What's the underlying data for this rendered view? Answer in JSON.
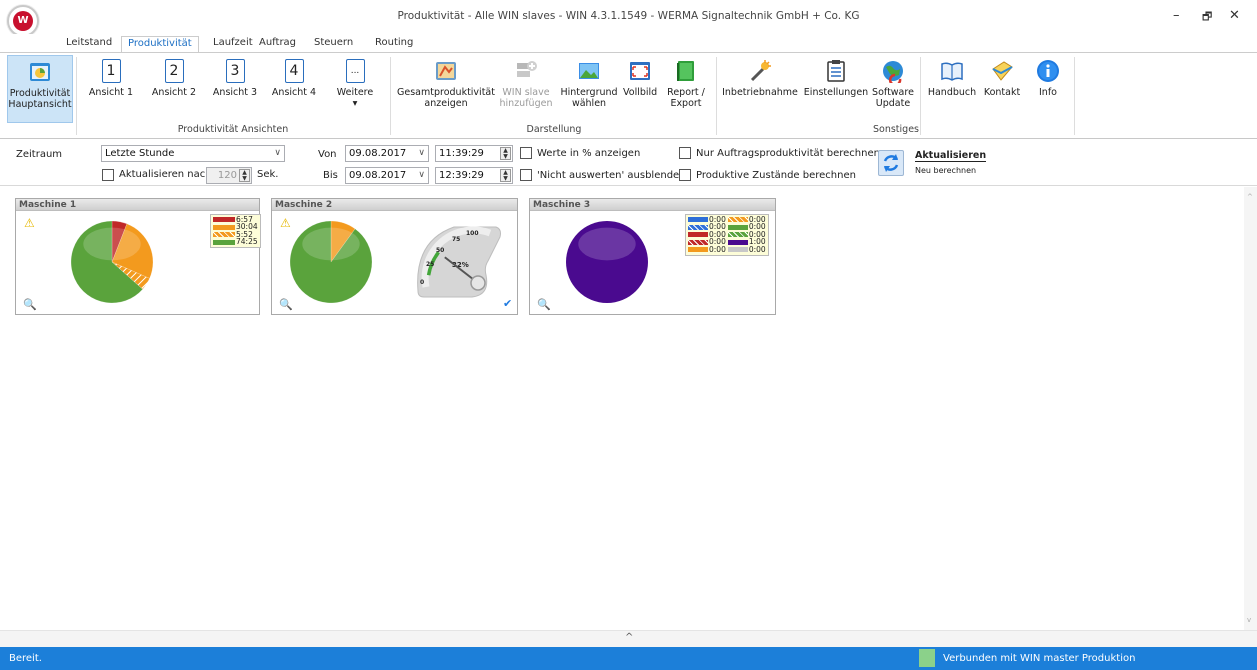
{
  "app": {
    "title": "Produktivität - Alle WIN slaves - WIN 4.3.1.1549 - WERMA Signaltechnik GmbH + Co. KG",
    "logo": "werma-logo"
  },
  "window_controls": {
    "minimize": "–",
    "restore": "🗗",
    "close": "✕",
    "ribbon_up": "^",
    "ribbon_min": "–",
    "ribbon_restore": "🗗",
    "ribbon_close": "✕"
  },
  "tabs": [
    "Leitstand",
    "Produktivität",
    "Laufzeit",
    "Auftrag",
    "Steuern",
    "Routing"
  ],
  "active_tab": "Produktivität",
  "ribbon": {
    "main": {
      "label": "Produktivität Hauptansicht",
      "line1": "Produktivität",
      "line2": "Hauptansicht"
    },
    "views": {
      "v1": "Ansicht 1",
      "v2": "Ansicht 2",
      "v3": "Ansicht 3",
      "v4": "Ansicht 4",
      "more": "Weitere",
      "n1": "1",
      "n2": "2",
      "n3": "3",
      "n4": "4",
      "more_icon": "...",
      "more_arrow": "▾"
    },
    "group_views": "Produktivität Ansichten",
    "gesamt": {
      "line1": "Gesamtproduktivität",
      "line2": "anzeigen"
    },
    "winslave": {
      "line1": "WIN slave",
      "line2": "hinzufügen"
    },
    "hintergrund": {
      "line1": "Hintergrund",
      "line2": "wählen"
    },
    "vollbild": "Vollbild",
    "report": {
      "line1": "Report /",
      "line2": "Export"
    },
    "group_darstellung": "Darstellung",
    "inbetrieb": "Inbetriebnahme",
    "einstellungen": "Einstellungen",
    "software": {
      "line1": "Software",
      "line2": "Update"
    },
    "handbuch": "Handbuch",
    "kontakt": "Kontakt",
    "info": "Info",
    "group_sonstiges": "Sonstiges"
  },
  "params": {
    "zeitraum_label": "Zeitraum",
    "zeitraum_value": "Letzte Stunde",
    "aktualisieren_nach": "Aktualisieren nach",
    "interval": "120",
    "sek": "Sek.",
    "von": "Von",
    "bis": "Bis",
    "von_date": "09.08.2017",
    "von_time": "11:39:29",
    "bis_date": "09.08.2017",
    "bis_time": "12:39:29",
    "werte_prozent": "Werte in % anzeigen",
    "nicht_auswerten": "'Nicht auswerten' ausblenden",
    "nur_auftrag": "Nur Auftragsproduktivität berechnen",
    "produktive": "Produktive Zustände berechnen",
    "refresh_title": "Aktualisieren",
    "refresh_sub": "Neu berechnen"
  },
  "colors": {
    "accent": "#1c7fd9",
    "green": "#5aa33c",
    "orange": "#f39a1e",
    "red": "#c02828",
    "purple": "#4a0a8f",
    "blue": "#2f6fd8",
    "gray": "#c8c8c8"
  },
  "machines": [
    {
      "name": "Maschine 1",
      "legend": [
        "6:57",
        "30:04",
        "5:52",
        "74:25"
      ],
      "pie": [
        {
          "color": "#c02828",
          "value": 6.95
        },
        {
          "color": "#f39a1e",
          "value": 30.07
        },
        {
          "color": "hatch",
          "value": 5.87
        },
        {
          "color": "#5aa33c",
          "value": 74.42
        }
      ]
    },
    {
      "name": "Maschine 2",
      "pie": [
        {
          "color": "#f39a1e",
          "value": 10
        },
        {
          "color": "#5aa33c",
          "value": 90
        }
      ],
      "gauge": {
        "value": 32,
        "percent": "32%",
        "ticks": [
          "0",
          "25",
          "50",
          "75",
          "100"
        ]
      }
    },
    {
      "name": "Maschine 3",
      "legend_left": [
        "0:00",
        "0:00",
        "0:00",
        "0:00",
        "0:00"
      ],
      "legend_right": [
        "0:00",
        "0:00",
        "0:00",
        "1:00",
        "0:00"
      ],
      "pie": [
        {
          "color": "#4a0a8f",
          "value": 100
        }
      ]
    }
  ],
  "status": {
    "left": "Bereit.",
    "right": "Verbunden mit WIN master Produktion"
  }
}
